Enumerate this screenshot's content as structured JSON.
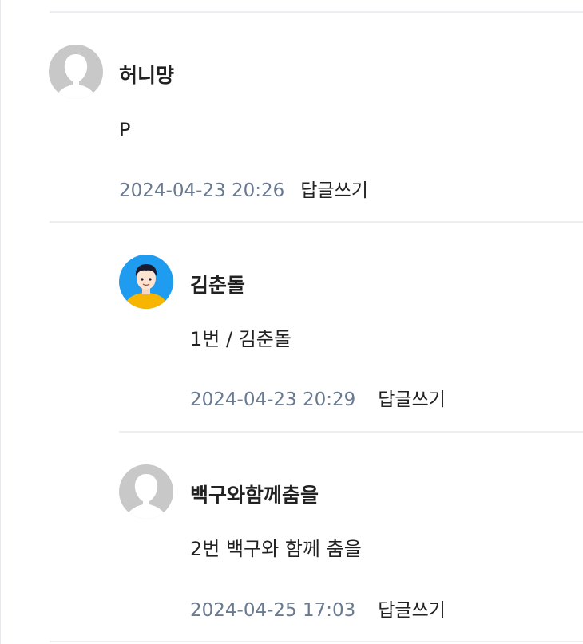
{
  "comments": [
    {
      "author": "허니먕",
      "text": "P",
      "date": "2024-04-23 20:26",
      "reply_label": "답글쓰기",
      "avatar": "default-avatar-icon"
    },
    {
      "author": "김춘돌",
      "text": "1번 / 김춘돌",
      "date": "2024-04-23 20:29",
      "reply_label": "답글쓰기",
      "avatar": "cartoon-boy-avatar"
    },
    {
      "author": "백구와함께춤을",
      "text": "2번 백구와 함께 춤을",
      "date": "2024-04-25 17:03",
      "reply_label": "답글쓰기",
      "avatar": "default-avatar-icon"
    }
  ],
  "colors": {
    "date": "#697a91",
    "divider": "#eceef1",
    "avatar_default": "#c8c8c8",
    "avatar_blue": "#1f9cf0",
    "avatar_shirt": "#f7b500"
  }
}
